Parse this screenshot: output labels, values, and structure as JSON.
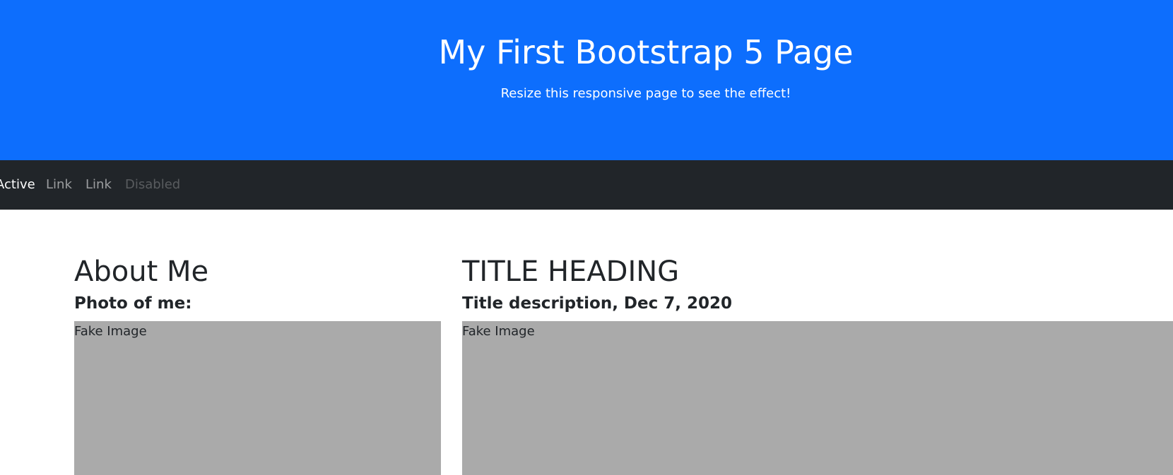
{
  "header": {
    "title": "My First Bootstrap 5 Page",
    "subtitle": "Resize this responsive page to see the effect!",
    "background_color": "#0d6efd"
  },
  "navbar": {
    "background_color": "#212529",
    "items": [
      {
        "label": "Active",
        "state": "active"
      },
      {
        "label": "Link",
        "state": "normal"
      },
      {
        "label": "Link",
        "state": "normal"
      },
      {
        "label": "Disabled",
        "state": "disabled"
      }
    ]
  },
  "sidebar": {
    "heading": "About Me",
    "subheading": "Photo of me:",
    "image_label": "Fake Image"
  },
  "main": {
    "heading": "TITLE HEADING",
    "subheading": "Title description, Dec 7, 2020",
    "image_label": "Fake Image"
  }
}
